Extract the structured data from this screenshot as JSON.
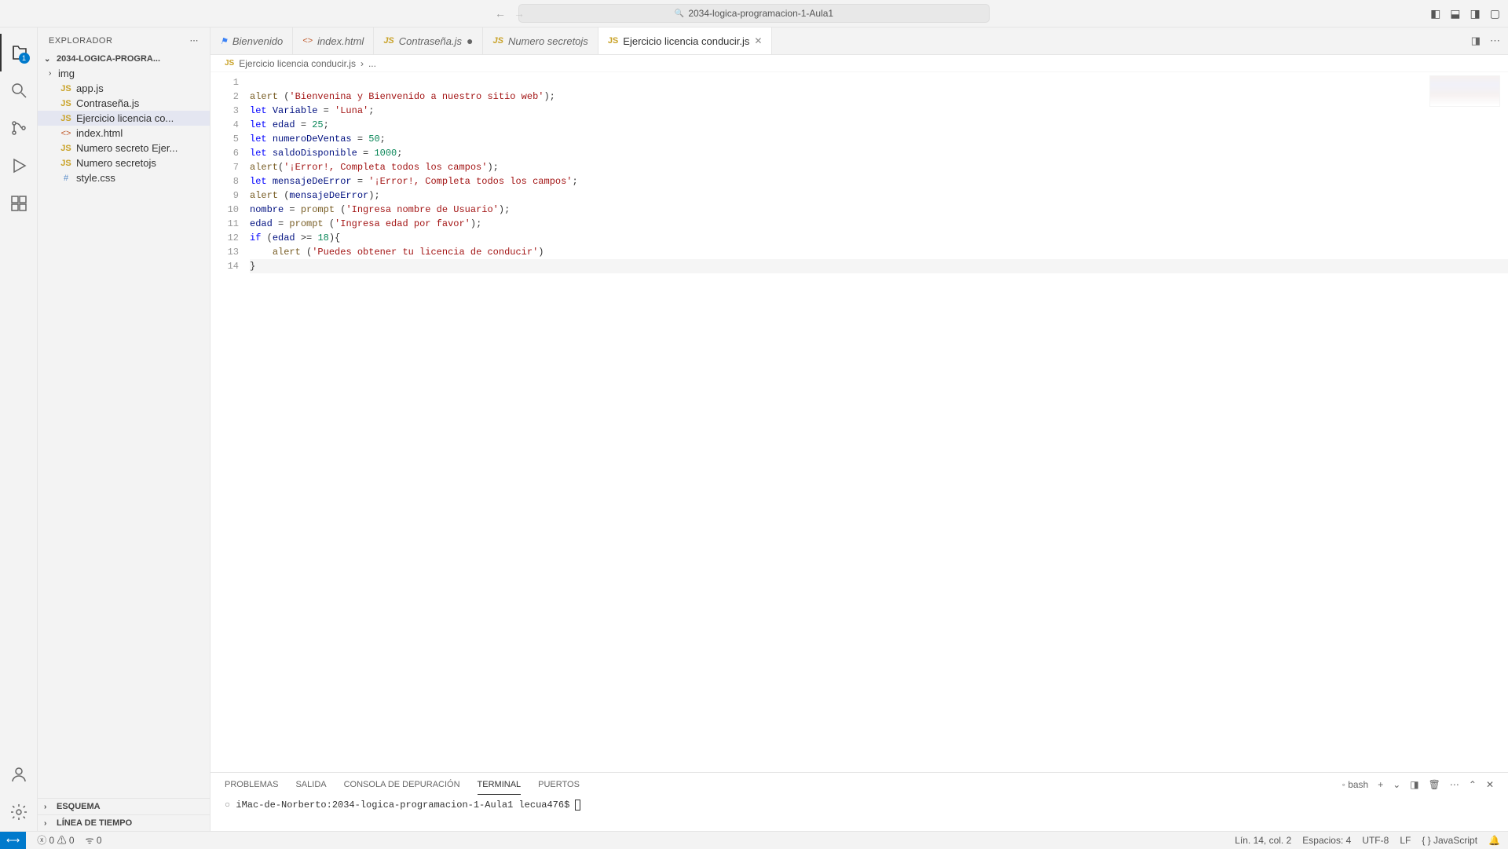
{
  "titlebar": {
    "search": "2034-logica-programacion-1-Aula1"
  },
  "activitybar": {
    "badge": "1"
  },
  "sidebar": {
    "title": "EXPLORADOR",
    "project": "2034-LOGICA-PROGRA...",
    "items": [
      {
        "icon": "›",
        "iconClass": "",
        "label": "img",
        "type": "folder"
      },
      {
        "icon": "JS",
        "iconClass": "ic-js",
        "label": "app.js"
      },
      {
        "icon": "JS",
        "iconClass": "ic-js",
        "label": "Contraseña.js"
      },
      {
        "icon": "JS",
        "iconClass": "ic-js",
        "label": "Ejercicio licencia co...",
        "selected": true
      },
      {
        "icon": "<>",
        "iconClass": "ic-html",
        "label": "index.html"
      },
      {
        "icon": "JS",
        "iconClass": "ic-js",
        "label": "Numero secreto Ejer..."
      },
      {
        "icon": "JS",
        "iconClass": "ic-js",
        "label": "Numero secretojs"
      },
      {
        "icon": "#",
        "iconClass": "ic-css",
        "label": "style.css"
      }
    ],
    "outline": "ESQUEMA",
    "timeline": "LÍNEA DE TIEMPO"
  },
  "tabs": [
    {
      "icon": "⚑",
      "iconClass": "",
      "label": "Bienvenido",
      "iconColor": "#3b82f6"
    },
    {
      "icon": "<>",
      "iconClass": "ic-html",
      "label": "index.html"
    },
    {
      "icon": "JS",
      "iconClass": "ic-js",
      "label": "Contraseña.js",
      "dirty": true
    },
    {
      "icon": "JS",
      "iconClass": "ic-js",
      "label": "Numero secretojs"
    },
    {
      "icon": "JS",
      "iconClass": "ic-js",
      "label": "Ejercicio licencia conducir.js",
      "active": true,
      "close": true
    }
  ],
  "breadcrumb": {
    "file": "Ejercicio licencia conducir.js",
    "sep": "›",
    "rest": "..."
  },
  "code": {
    "lines": [
      "",
      "<span class='tok-fn'>alert</span> (<span class='tok-str'>'Bienvenina y Bienvenido a nuestro sitio web'</span>);",
      "<span class='tok-kw'>let</span> <span class='tok-var'>Variable</span> = <span class='tok-str'>'Luna'</span>;",
      "<span class='tok-kw'>let</span> <span class='tok-var'>edad</span> = <span class='tok-num'>25</span>;",
      "<span class='tok-kw'>let</span> <span class='tok-var'>numeroDeVentas</span> = <span class='tok-num'>50</span>;",
      "<span class='tok-kw'>let</span> <span class='tok-var'>saldoDisponible</span> = <span class='tok-num'>1000</span>;",
      "<span class='tok-fn'>alert</span>(<span class='tok-str'>'¡Error!, Completa todos los campos'</span>);",
      "<span class='tok-kw'>let</span> <span class='tok-var'>mensajeDeError</span> = <span class='tok-str'>'¡Error!, Completa todos los campos'</span>;",
      "<span class='tok-fn'>alert</span> (<span class='tok-var'>mensajeDeError</span>);",
      "<span class='tok-var'>nombre</span> = <span class='tok-fn'>prompt</span> (<span class='tok-str'>'Ingresa nombre de Usuario'</span>);",
      "<span class='tok-var'>edad</span> = <span class='tok-fn'>prompt</span> (<span class='tok-str'>'Ingresa edad por favor'</span>);",
      "<span class='tok-kw'>if</span> (<span class='tok-var'>edad</span> &gt;= <span class='tok-num'>18</span>){",
      "    <span class='tok-fn'>alert</span> (<span class='tok-str'>'Puedes obtener tu licencia de conducir'</span>)",
      "}"
    ]
  },
  "panel": {
    "tabs": [
      "PROBLEMAS",
      "SALIDA",
      "CONSOLA DE DEPURACIÓN",
      "TERMINAL",
      "PUERTOS"
    ],
    "activeTab": 3,
    "shell": "bash",
    "prompt": "iMac-de-Norberto:2034-logica-programacion-1-Aula1 lecua476$ "
  },
  "statusbar": {
    "errors": "0",
    "warnings": "0",
    "ports": "0",
    "position": "Lín. 14, col. 2",
    "spaces": "Espacios: 4",
    "encoding": "UTF-8",
    "eol": "LF",
    "lang": "{ } JavaScript"
  }
}
